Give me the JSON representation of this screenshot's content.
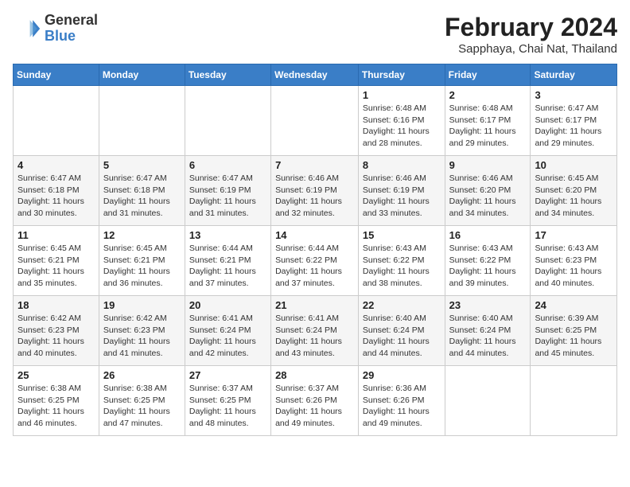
{
  "header": {
    "logo": {
      "line1": "General",
      "line2": "Blue"
    },
    "title": "February 2024",
    "subtitle": "Sapphaya, Chai Nat, Thailand"
  },
  "weekdays": [
    "Sunday",
    "Monday",
    "Tuesday",
    "Wednesday",
    "Thursday",
    "Friday",
    "Saturday"
  ],
  "weeks": [
    [
      {
        "day": "",
        "info": ""
      },
      {
        "day": "",
        "info": ""
      },
      {
        "day": "",
        "info": ""
      },
      {
        "day": "",
        "info": ""
      },
      {
        "day": "1",
        "info": "Sunrise: 6:48 AM\nSunset: 6:16 PM\nDaylight: 11 hours and 28 minutes."
      },
      {
        "day": "2",
        "info": "Sunrise: 6:48 AM\nSunset: 6:17 PM\nDaylight: 11 hours and 29 minutes."
      },
      {
        "day": "3",
        "info": "Sunrise: 6:47 AM\nSunset: 6:17 PM\nDaylight: 11 hours and 29 minutes."
      }
    ],
    [
      {
        "day": "4",
        "info": "Sunrise: 6:47 AM\nSunset: 6:18 PM\nDaylight: 11 hours and 30 minutes."
      },
      {
        "day": "5",
        "info": "Sunrise: 6:47 AM\nSunset: 6:18 PM\nDaylight: 11 hours and 31 minutes."
      },
      {
        "day": "6",
        "info": "Sunrise: 6:47 AM\nSunset: 6:19 PM\nDaylight: 11 hours and 31 minutes."
      },
      {
        "day": "7",
        "info": "Sunrise: 6:46 AM\nSunset: 6:19 PM\nDaylight: 11 hours and 32 minutes."
      },
      {
        "day": "8",
        "info": "Sunrise: 6:46 AM\nSunset: 6:19 PM\nDaylight: 11 hours and 33 minutes."
      },
      {
        "day": "9",
        "info": "Sunrise: 6:46 AM\nSunset: 6:20 PM\nDaylight: 11 hours and 34 minutes."
      },
      {
        "day": "10",
        "info": "Sunrise: 6:45 AM\nSunset: 6:20 PM\nDaylight: 11 hours and 34 minutes."
      }
    ],
    [
      {
        "day": "11",
        "info": "Sunrise: 6:45 AM\nSunset: 6:21 PM\nDaylight: 11 hours and 35 minutes."
      },
      {
        "day": "12",
        "info": "Sunrise: 6:45 AM\nSunset: 6:21 PM\nDaylight: 11 hours and 36 minutes."
      },
      {
        "day": "13",
        "info": "Sunrise: 6:44 AM\nSunset: 6:21 PM\nDaylight: 11 hours and 37 minutes."
      },
      {
        "day": "14",
        "info": "Sunrise: 6:44 AM\nSunset: 6:22 PM\nDaylight: 11 hours and 37 minutes."
      },
      {
        "day": "15",
        "info": "Sunrise: 6:43 AM\nSunset: 6:22 PM\nDaylight: 11 hours and 38 minutes."
      },
      {
        "day": "16",
        "info": "Sunrise: 6:43 AM\nSunset: 6:22 PM\nDaylight: 11 hours and 39 minutes."
      },
      {
        "day": "17",
        "info": "Sunrise: 6:43 AM\nSunset: 6:23 PM\nDaylight: 11 hours and 40 minutes."
      }
    ],
    [
      {
        "day": "18",
        "info": "Sunrise: 6:42 AM\nSunset: 6:23 PM\nDaylight: 11 hours and 40 minutes."
      },
      {
        "day": "19",
        "info": "Sunrise: 6:42 AM\nSunset: 6:23 PM\nDaylight: 11 hours and 41 minutes."
      },
      {
        "day": "20",
        "info": "Sunrise: 6:41 AM\nSunset: 6:24 PM\nDaylight: 11 hours and 42 minutes."
      },
      {
        "day": "21",
        "info": "Sunrise: 6:41 AM\nSunset: 6:24 PM\nDaylight: 11 hours and 43 minutes."
      },
      {
        "day": "22",
        "info": "Sunrise: 6:40 AM\nSunset: 6:24 PM\nDaylight: 11 hours and 44 minutes."
      },
      {
        "day": "23",
        "info": "Sunrise: 6:40 AM\nSunset: 6:24 PM\nDaylight: 11 hours and 44 minutes."
      },
      {
        "day": "24",
        "info": "Sunrise: 6:39 AM\nSunset: 6:25 PM\nDaylight: 11 hours and 45 minutes."
      }
    ],
    [
      {
        "day": "25",
        "info": "Sunrise: 6:38 AM\nSunset: 6:25 PM\nDaylight: 11 hours and 46 minutes."
      },
      {
        "day": "26",
        "info": "Sunrise: 6:38 AM\nSunset: 6:25 PM\nDaylight: 11 hours and 47 minutes."
      },
      {
        "day": "27",
        "info": "Sunrise: 6:37 AM\nSunset: 6:25 PM\nDaylight: 11 hours and 48 minutes."
      },
      {
        "day": "28",
        "info": "Sunrise: 6:37 AM\nSunset: 6:26 PM\nDaylight: 11 hours and 49 minutes."
      },
      {
        "day": "29",
        "info": "Sunrise: 6:36 AM\nSunset: 6:26 PM\nDaylight: 11 hours and 49 minutes."
      },
      {
        "day": "",
        "info": ""
      },
      {
        "day": "",
        "info": ""
      }
    ]
  ]
}
